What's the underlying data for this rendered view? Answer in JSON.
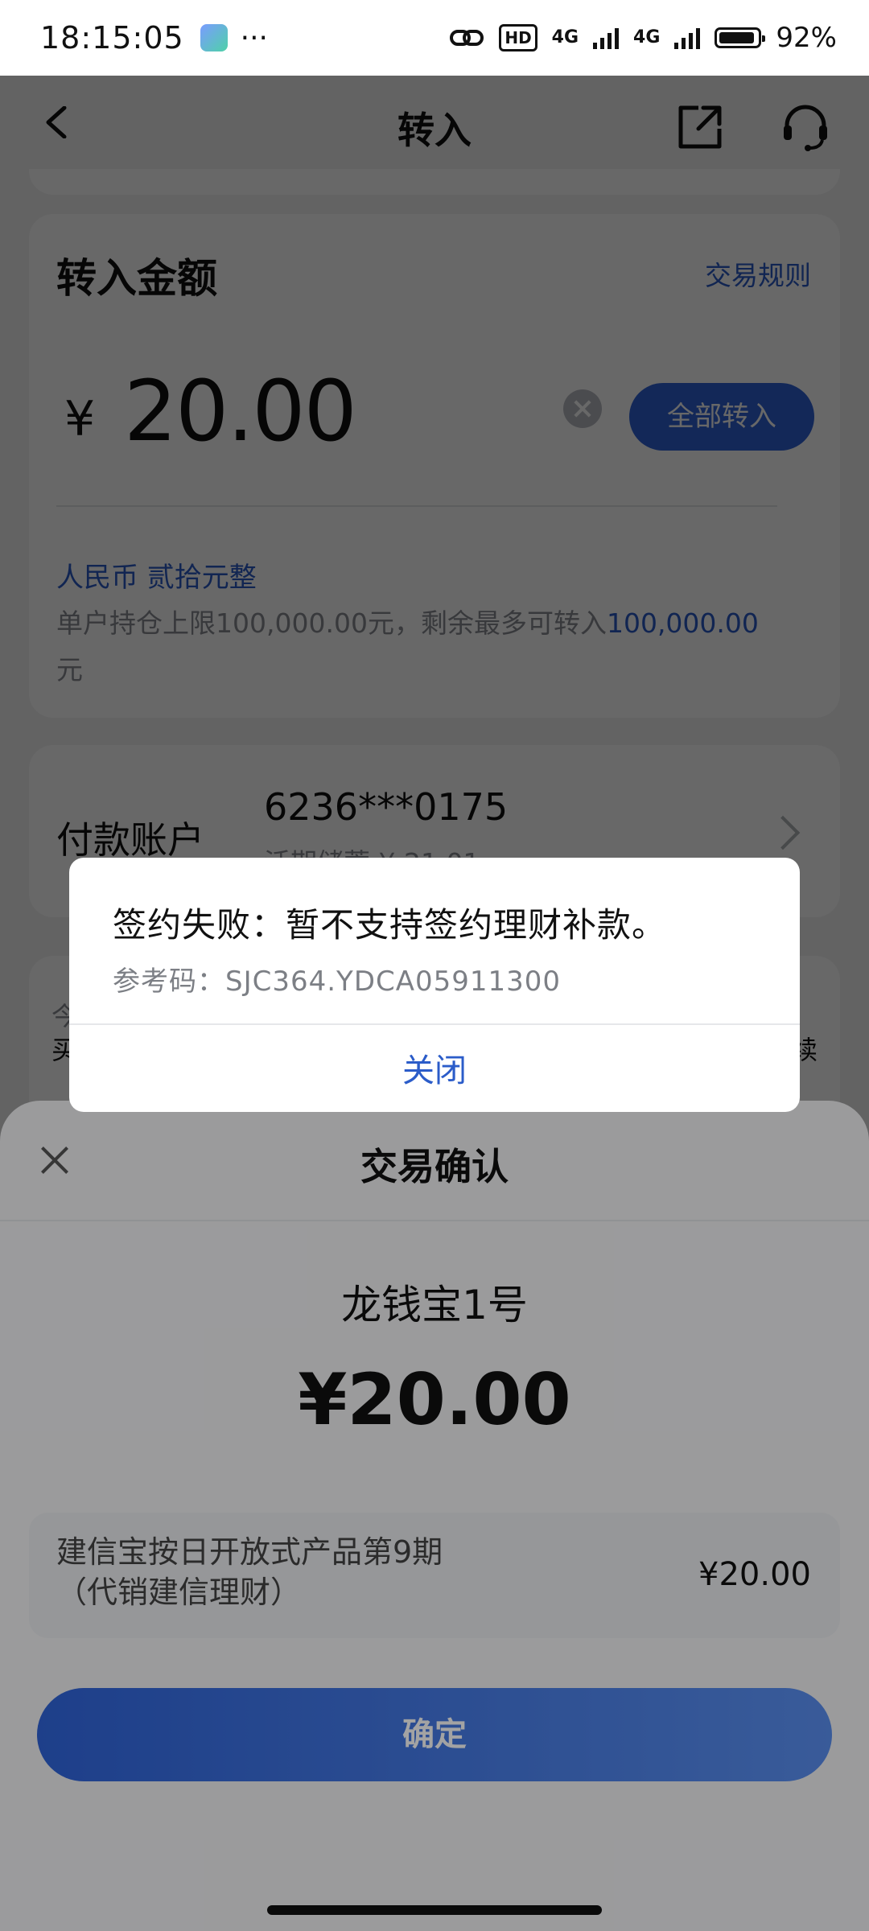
{
  "status_bar": {
    "time": "18:15:05",
    "dots": "···",
    "hd": "HD",
    "net1": "4G",
    "net2": "4G",
    "battery": "92%"
  },
  "navbar": {
    "title": "转入"
  },
  "transfer_card": {
    "heading": "转入金额",
    "rules_link": "交易规则",
    "currency_symbol": "¥",
    "amount": "20.00",
    "all_in_button": "全部转入",
    "amount_uppercase": "人民币 贰拾元整",
    "limit_text": "单户持仓上限100,000.00元，剩余最多可转入",
    "limit_value": "100,000.00",
    "limit_unit": "元"
  },
  "payment_card": {
    "label": "付款账户",
    "account": "6236***0175",
    "balance": "活期储蓄 ¥ 21.01"
  },
  "notice_card": {
    "line1": "今",
    "line2": "买",
    "line2_right": "续"
  },
  "sheet": {
    "title": "交易确认",
    "product_name": "龙钱宝1号",
    "amount": "¥20.00",
    "detail_name": "建信宝按日开放式产品第9期\n（代销建信理财）",
    "detail_value": "¥20.00",
    "confirm_button": "确定"
  },
  "dialog": {
    "message": "签约失败：暂不支持签约理财补款。",
    "ref_label": "参考码：",
    "ref_code": "SJC364.YDCA05911300",
    "close_button": "关闭"
  },
  "colors": {
    "accent": "#2f63d8",
    "link": "#2b5cc9"
  }
}
